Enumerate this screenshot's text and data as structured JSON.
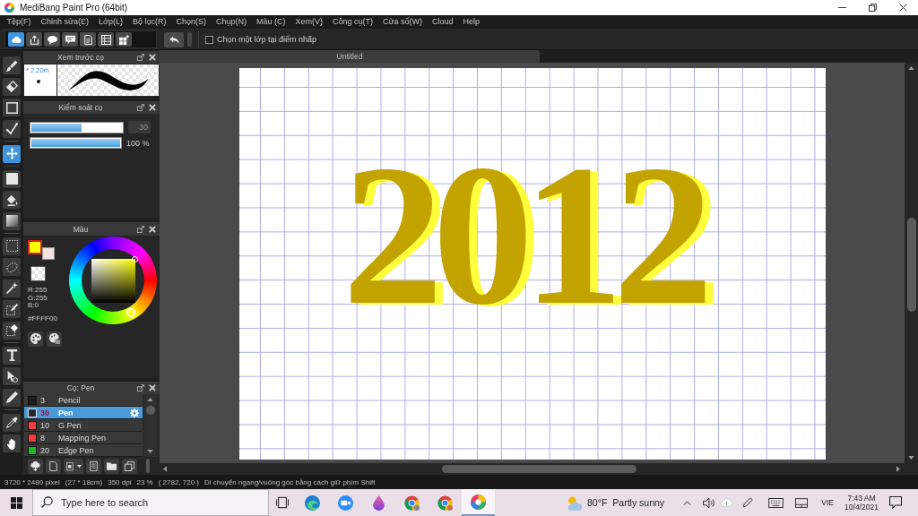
{
  "window": {
    "title": "MediBang Paint Pro (64bit)"
  },
  "menu": [
    "Tệp(F)",
    "Chỉnh sửa(E)",
    "Lớp(L)",
    "Bộ lọc(R)",
    "Chọn(S)",
    "Chụp(N)",
    "Màu (C)",
    "Xem(V)",
    "Công cụ(T)",
    "Cửa sổ(W)",
    "Cloud",
    "Help"
  ],
  "toolbar": {
    "buttons": [
      {
        "selected": true
      },
      {
        "selected": false
      },
      {
        "selected": false
      },
      {
        "selected": false
      },
      {
        "selected": false
      },
      {
        "selected": false
      },
      {
        "selected": false
      }
    ],
    "checkbox": {
      "label": "Chọn một lớp tại điểm nhấp",
      "checked": false
    }
  },
  "tool_groups": [
    {
      "tools": [
        {
          "selected": false
        },
        {
          "selected": false
        },
        {
          "selected": false
        },
        {
          "selected": false
        }
      ]
    },
    {
      "tools": [
        {
          "selected": true
        }
      ]
    },
    {
      "tools": [
        {
          "selected": false
        },
        {
          "selected": false
        },
        {
          "selected": false
        }
      ]
    },
    {
      "tools": [
        {
          "selected": false
        },
        {
          "selected": false
        },
        {
          "selected": false
        },
        {
          "selected": false
        },
        {
          "selected": false
        }
      ]
    },
    {
      "tools": [
        {
          "selected": false
        },
        {
          "selected": false
        },
        {
          "selected": false
        }
      ]
    },
    {
      "tools": [
        {
          "selected": false
        },
        {
          "selected": false
        }
      ]
    }
  ],
  "brush_preview": {
    "title": "Xem trước cọ",
    "size": "* 2.20m"
  },
  "brush_control": {
    "title": "Kiểm soát cọ",
    "sliders": [
      {
        "kind": "boxed",
        "level": 0.55,
        "reading": "30"
      },
      {
        "kind": "plain",
        "level": 1,
        "reading": "100 %"
      }
    ]
  },
  "color_panel": {
    "title": "Màu",
    "swatches": [
      {
        "color": "#ffff00",
        "selected": true
      },
      {
        "color": "#f2e2e2",
        "selected": false
      }
    ],
    "channels": [
      "R:255",
      "G:255",
      "B:0"
    ],
    "hex": "#FFFF00"
  },
  "brush_list": {
    "title": "Cọ: Pen",
    "brushes": [
      {
        "size": "3",
        "name": "Pencil",
        "color": "#1c1c1c",
        "selected": false
      },
      {
        "size": "30",
        "name": "Pen",
        "color": "#2a2a2a",
        "selected": true
      },
      {
        "size": "10",
        "name": "G Pen",
        "color": "#f03c3c",
        "selected": false
      },
      {
        "size": "8",
        "name": "Mapping Pen",
        "color": "#f03c3c",
        "selected": false
      },
      {
        "size": "20",
        "name": "Edge Pen",
        "color": "#1fb81f",
        "selected": false
      }
    ]
  },
  "document_tabs": [
    {
      "label": "Untitled",
      "selected": true
    }
  ],
  "canvas": {
    "lettering": "2012"
  },
  "status_bar": [
    "3720 * 2480 pixel",
    "(27 * 18cm)",
    "350 dpi",
    "23 %",
    "( 2782, 720 )",
    "Di chuyển ngang/vuông góc bằng cách giữ phím Shift"
  ],
  "taskbar": {
    "search": {
      "placeholder": "Type here to search"
    },
    "apps": [
      {
        "active": false
      },
      {
        "active": false
      },
      {
        "active": false
      },
      {
        "active": false
      },
      {
        "active": false
      },
      {
        "active": true
      }
    ],
    "weather": {
      "temperature": "80°F",
      "condition": "Partly sunny"
    },
    "language": "VIE",
    "time": "7:43 AM",
    "date": "10/4/2021"
  }
}
